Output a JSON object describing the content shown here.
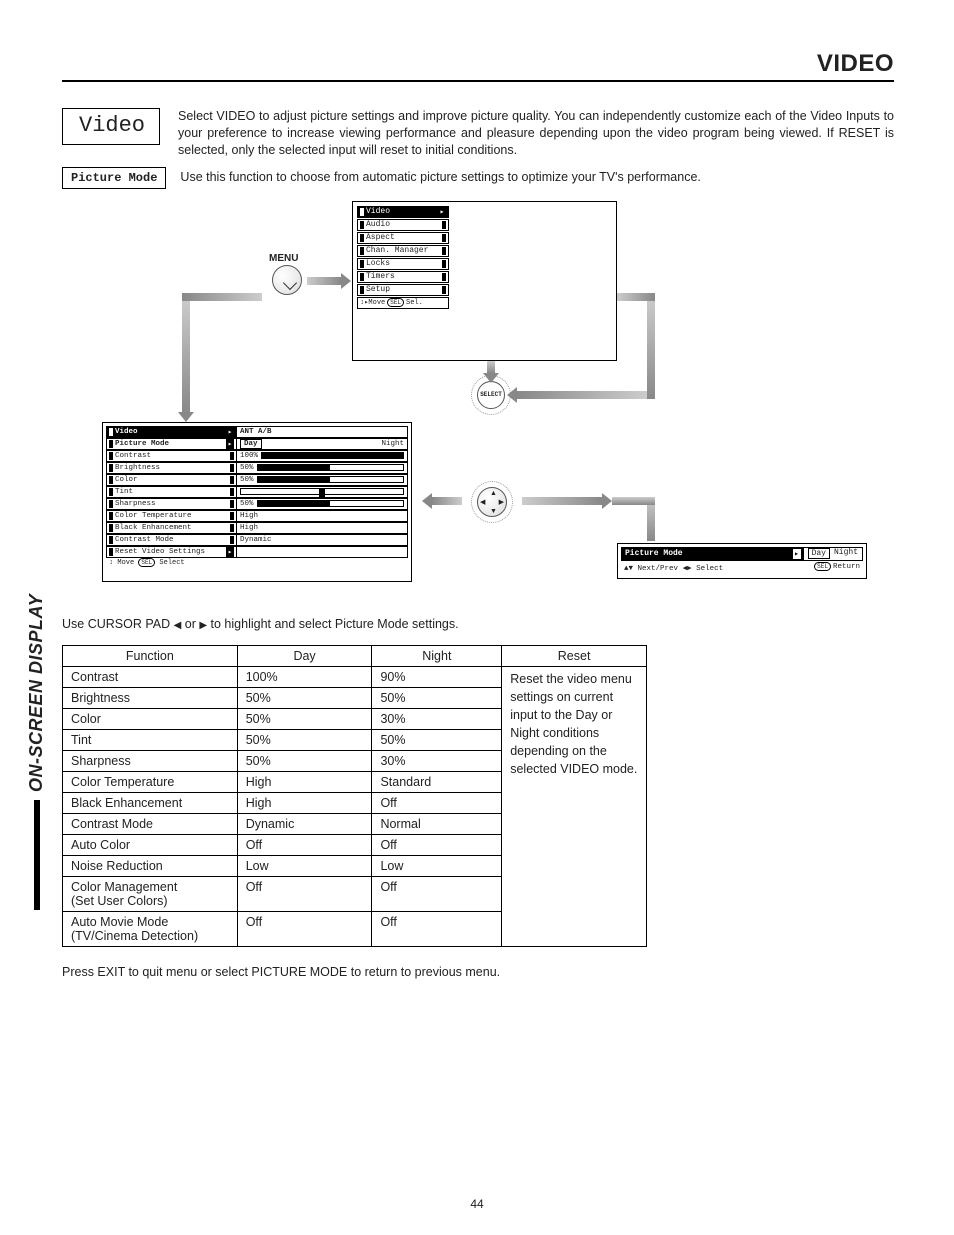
{
  "header": {
    "title": "VIDEO"
  },
  "video_box": "Video",
  "intro": "Select VIDEO to adjust picture settings and improve picture quality.  You can independently customize each of the Video Inputs to your preference to increase viewing performance and pleasure depending upon the video program being viewed.  If RESET is selected, only the selected input will reset to initial conditions.",
  "picmode_box": "Picture Mode",
  "picmode_text": "Use this function to choose from automatic picture settings to optimize your TV's performance.",
  "menu_label": "MENU",
  "top_menu": {
    "items": [
      "Video",
      "Audio",
      "Aspect",
      "Chan. Manager",
      "Locks",
      "Timers",
      "Setup"
    ],
    "footer_left": "Move",
    "footer_sel": "SEL",
    "footer_right": "Sel."
  },
  "dial_label": "SELECT",
  "video_osd": {
    "header_left": "Video",
    "header_right": "ANT A/B",
    "rows": [
      {
        "label": "Picture Mode",
        "type": "daynight",
        "day": "Day",
        "night": "Night"
      },
      {
        "label": "Contrast",
        "type": "slider",
        "pct": "100%",
        "fill": 100
      },
      {
        "label": "Brightness",
        "type": "slider",
        "pct": "50%",
        "fill": 50
      },
      {
        "label": "Color",
        "type": "slider",
        "pct": "50%",
        "fill": 50
      },
      {
        "label": "Tint",
        "type": "tint"
      },
      {
        "label": "Sharpness",
        "type": "slider",
        "pct": "50%",
        "fill": 50
      },
      {
        "label": "Color Temperature",
        "type": "text",
        "val": "High"
      },
      {
        "label": "Black Enhancement",
        "type": "text",
        "val": "High"
      },
      {
        "label": "Contrast Mode",
        "type": "text",
        "val": "Dynamic"
      },
      {
        "label": "Reset Video Settings",
        "type": "reset"
      }
    ],
    "footer": "Move  SEL  Select"
  },
  "right_strip": {
    "label": "Picture Mode",
    "day": "Day",
    "night": "Night",
    "nextprev": "Next/Prev",
    "select": "Select",
    "return_btn": "SEL",
    "return": "Return"
  },
  "cursor_note_pre": "Use CURSOR PAD ",
  "cursor_note_mid": " or ",
  "cursor_note_post": " to highlight and select Picture Mode settings.",
  "table": {
    "headers": [
      "Function",
      "Day",
      "Night",
      "Reset"
    ],
    "rows": [
      {
        "f": "Contrast",
        "d": "100%",
        "n": "90%"
      },
      {
        "f": "Brightness",
        "d": "50%",
        "n": "50%"
      },
      {
        "f": "Color",
        "d": "50%",
        "n": "30%"
      },
      {
        "f": "Tint",
        "d": "50%",
        "n": "50%"
      },
      {
        "f": "Sharpness",
        "d": "50%",
        "n": "30%"
      },
      {
        "f": "Color Temperature",
        "d": "High",
        "n": "Standard"
      },
      {
        "f": "Black Enhancement",
        "d": "High",
        "n": "Off"
      },
      {
        "f": "Contrast Mode",
        "d": "Dynamic",
        "n": "Normal"
      },
      {
        "f": "Auto Color",
        "d": "Off",
        "n": "Off"
      },
      {
        "f": "Noise Reduction",
        "d": "Low",
        "n": "Low"
      },
      {
        "f": "Color Management (Set User Colors)",
        "d": "Off",
        "n": "Off"
      },
      {
        "f": "Auto Movie Mode (TV/Cinema Detection)",
        "d": "Off",
        "n": "Off"
      }
    ],
    "reset_text": "Reset the video menu settings on current input to the Day or Night conditions depending on the selected VIDEO mode."
  },
  "closing": "Press EXIT to quit menu or select PICTURE MODE to return to previous menu.",
  "side_label": "ON-SCREEN DISPLAY",
  "page_number": "44"
}
